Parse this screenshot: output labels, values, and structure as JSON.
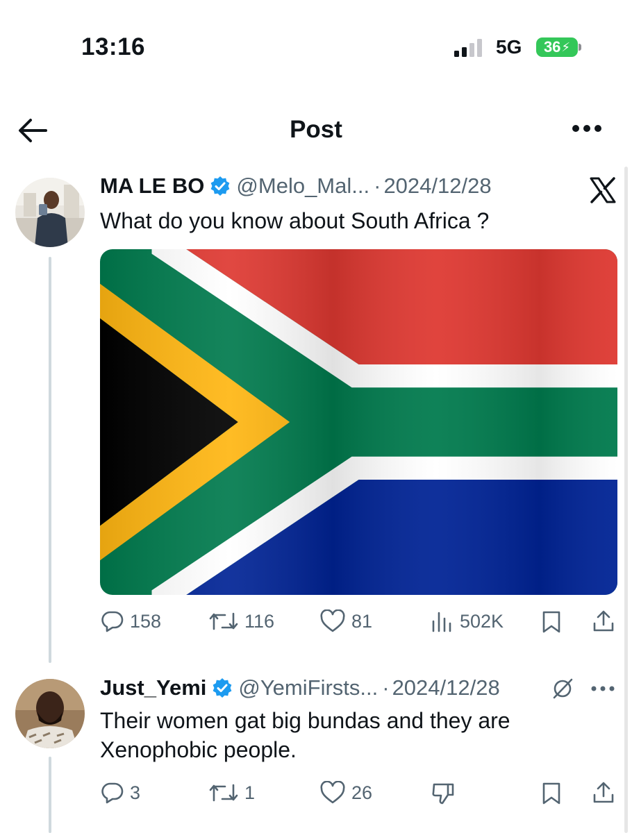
{
  "status_bar": {
    "time": "13:16",
    "network": "5G",
    "battery": "36"
  },
  "header": {
    "title": "Post"
  },
  "post": {
    "name": "MA LE BO",
    "handle": "@Melo_Mal...",
    "separator": "·",
    "date": "2024/12/28",
    "text": "What do you know about South Africa ?",
    "stats": {
      "replies": "158",
      "reposts": "116",
      "likes": "81",
      "views": "502K"
    }
  },
  "reply": {
    "name": "Just_Yemi",
    "handle": "@YemiFirsts...",
    "separator": "·",
    "date": "2024/12/28",
    "text": "Their women gat big bundas and they are Xenophobic people.",
    "stats": {
      "replies": "3",
      "reposts": "1",
      "likes": "26"
    }
  },
  "colors": {
    "verified": "#1d9bf0",
    "flag_red": "#de3831",
    "flag_blue": "#002395",
    "flag_green": "#007a4d",
    "flag_gold": "#ffb612",
    "flag_black": "#000000",
    "battery_green": "#34c759",
    "secondary_text": "#536471"
  },
  "icons": [
    "back-arrow-icon",
    "more-icon",
    "x-logo-icon",
    "verified-icon",
    "reply-icon",
    "repost-icon",
    "like-icon",
    "views-icon",
    "bookmark-icon",
    "share-icon",
    "grok-icon",
    "dislike-icon"
  ]
}
